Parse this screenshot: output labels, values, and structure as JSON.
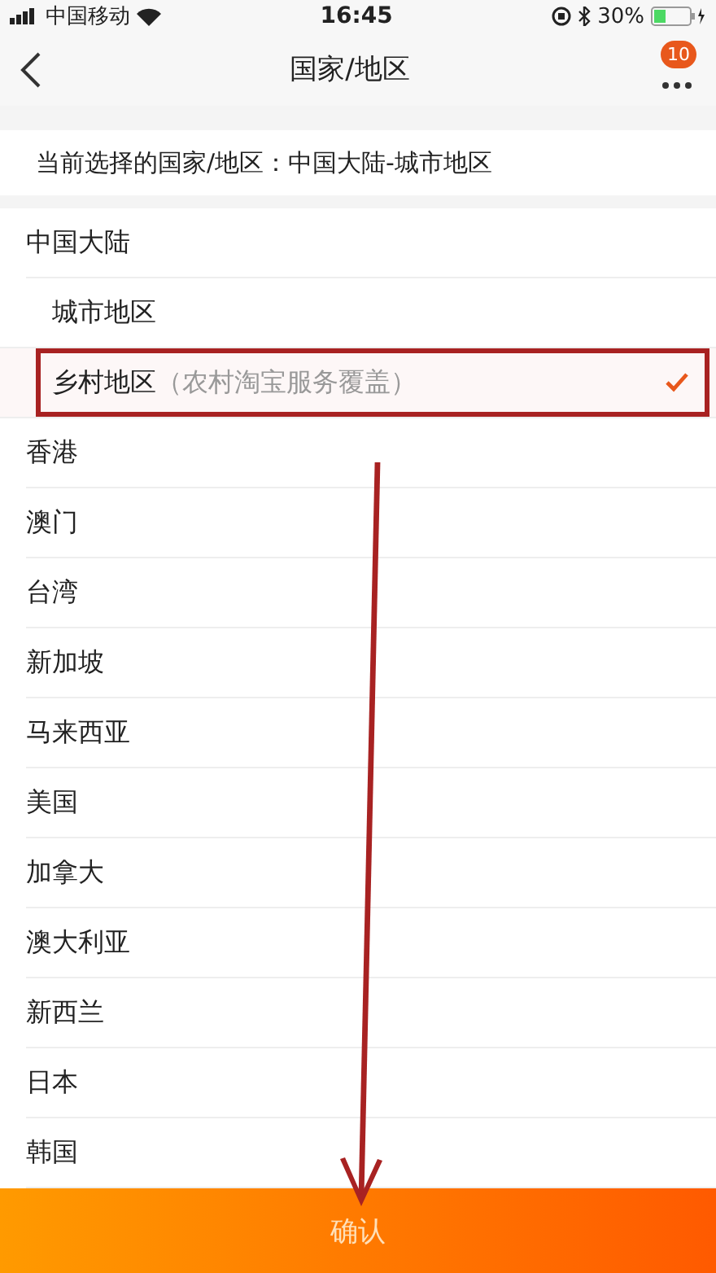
{
  "status_bar": {
    "carrier": "中国移动",
    "time": "16:45",
    "battery": "30%"
  },
  "nav": {
    "title": "国家/地区",
    "badge": "10"
  },
  "current": "当前选择的国家/地区：中国大陆-城市地区",
  "regions": [
    {
      "name": "中国大陆",
      "children": [
        {
          "name": "城市地区",
          "selected": false
        },
        {
          "name": "乡村地区",
          "note": "（农村淘宝服务覆盖）",
          "selected": true
        }
      ]
    },
    {
      "name": "香港",
      "selected": false
    },
    {
      "name": "澳门",
      "selected": false
    },
    {
      "name": "台湾",
      "selected": false
    },
    {
      "name": "新加坡",
      "selected": false
    },
    {
      "name": "马来西亚",
      "selected": false
    },
    {
      "name": "美国",
      "selected": false
    },
    {
      "name": "加拿大",
      "selected": false
    },
    {
      "name": "澳大利亚",
      "selected": false
    },
    {
      "name": "新西兰",
      "selected": false
    },
    {
      "name": "日本",
      "selected": false
    },
    {
      "name": "韩国",
      "selected": false
    }
  ],
  "confirm_button": "确认"
}
